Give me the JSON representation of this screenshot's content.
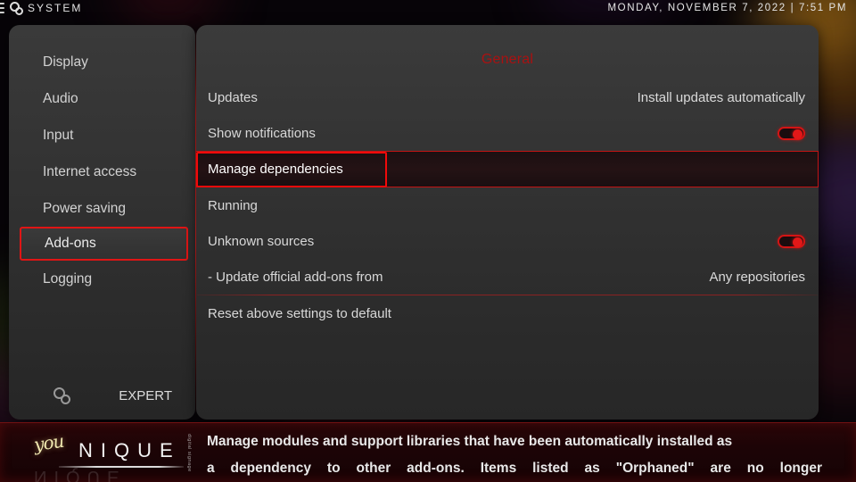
{
  "topbar": {
    "menu_icon": "hamburger-icon",
    "system_icon": "cogs-icon",
    "title": "SYSTEM",
    "datetime": "MONDAY, NOVEMBER 7, 2022 | 7:51 PM"
  },
  "sidebar": {
    "items": [
      {
        "label": "Display",
        "selected": false
      },
      {
        "label": "Audio",
        "selected": false
      },
      {
        "label": "Input",
        "selected": false
      },
      {
        "label": "Internet access",
        "selected": false
      },
      {
        "label": "Power saving",
        "selected": false
      },
      {
        "label": "Add-ons",
        "selected": true
      },
      {
        "label": "Logging",
        "selected": false
      }
    ],
    "footer": {
      "level_icon": "cogs-icon",
      "level_label": "EXPERT"
    }
  },
  "content": {
    "category_title": "General",
    "rows": [
      {
        "label": "Updates",
        "value": "Install updates automatically",
        "control": "value",
        "focused": false
      },
      {
        "label": "Show notifications",
        "value": "",
        "control": "toggle",
        "toggle_on": true,
        "focused": false
      },
      {
        "label": "Manage dependencies",
        "value": "",
        "control": "none",
        "focused": true
      },
      {
        "label": "Running",
        "value": "",
        "control": "none",
        "focused": false
      },
      {
        "label": "Unknown sources",
        "value": "",
        "control": "toggle",
        "toggle_on": true,
        "focused": false
      },
      {
        "label": "- Update official add-ons from",
        "value": "Any repositories",
        "control": "value",
        "focused": false
      },
      {
        "label": "Reset above settings to default",
        "value": "",
        "control": "none",
        "focused": false
      }
    ]
  },
  "description": {
    "line1": "Manage modules and support libraries that have been automatically installed as",
    "line2": "a dependency to other add-ons. Items listed as \"Orphaned\" are no longer"
  },
  "logo": {
    "you": "you",
    "nique": "NIQUE",
    "reflection": "NIQUE",
    "tagline": "digital signage"
  },
  "colors": {
    "accent_red": "#e01515",
    "title_red": "#aa1111",
    "panel_bg": "#333333",
    "text_primary": "#d8d8d8"
  }
}
